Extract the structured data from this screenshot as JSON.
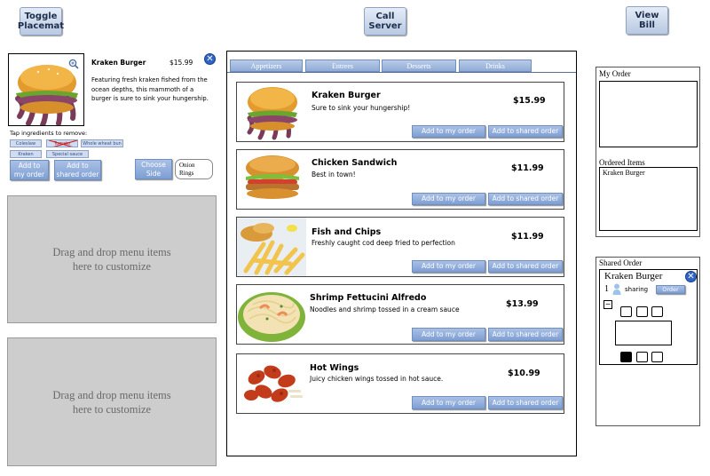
{
  "toolbar": {
    "toggle_placemat": "Toggle\nPlacemat",
    "call_server": "Call\nServer",
    "view_bill": "View\nBill"
  },
  "detail": {
    "name": "Kraken Burger",
    "price": "$15.99",
    "description": "Featuring fresh kraken fished from the ocean depths, this mammoth of a burger is sure to sink your hungership.",
    "tap_label": "Tap ingredients to remove:",
    "ingredients": [
      "Coleslaw",
      "Tomato",
      "Whole wheat bun",
      "Kraken",
      "Special sauce"
    ],
    "add_my_order": "Add to\nmy order",
    "add_shared": "Add to\nshared order",
    "choose_side": "Choose\nSide",
    "side_value": "Onion\nRings"
  },
  "drop_zones": [
    "Drag and drop menu items\nhere to customize",
    "Drag and drop menu items\nhere to customize"
  ],
  "tabs": [
    "Appetizers",
    "Entrees",
    "Desserts",
    "Drinks"
  ],
  "menu_items": [
    {
      "name": "Kraken Burger",
      "desc": "Sure to sink your hungership!",
      "price": "$15.99",
      "btn_my": "Add to my order",
      "btn_shared": "Add to shared order"
    },
    {
      "name": "Chicken Sandwich",
      "desc": "Best in town!",
      "price": "$11.99",
      "btn_my": "Add to my order",
      "btn_shared": "Add to shared order"
    },
    {
      "name": "Fish and Chips",
      "desc": "Freshly caught cod deep fried to perfection",
      "price": "$11.99",
      "btn_my": "Add to my order",
      "btn_shared": "Add to shared order"
    },
    {
      "name": "Shrimp Fettucini Alfredo",
      "desc": "Noodles and shrimp tossed in a cream sauce",
      "price": "$13.99",
      "btn_my": "Add to my order",
      "btn_shared": "Add to shared order"
    },
    {
      "name": "Hot Wings",
      "desc": "Juicy chicken wings tossed in hot sauce.",
      "price": "$10.99",
      "btn_my": "Add to my order",
      "btn_shared": "Add to shared order"
    }
  ],
  "my_order": {
    "title": "My Order",
    "ordered_title": "Ordered Items",
    "ordered_items": [
      "Kraken Burger"
    ]
  },
  "shared_order": {
    "title": "Shared Order",
    "item_name": "Kraken Burger",
    "count": "1",
    "sharing_label": "sharing",
    "order_btn": "Order",
    "minus": "−"
  },
  "colors": {
    "accent": "#7e9fd3",
    "panel_gray": "#cdcdcd",
    "remove_mark": "#d02020"
  }
}
